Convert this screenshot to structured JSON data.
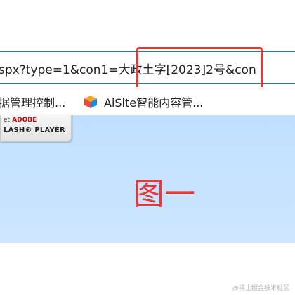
{
  "address_bar": {
    "url_text": "spx?type=1&con1=大政土字[2023]2号&con"
  },
  "bookmarks": [
    {
      "label": "据管理控制..."
    },
    {
      "label": "AiSite智能内容管...",
      "icon": "colorful-cube-icon"
    }
  ],
  "flash_banner": {
    "line1_get": "et",
    "line1_brand": "ADOBE",
    "line2": "LASH® PLAYER"
  },
  "figure_label": "图一",
  "watermark": "@稀土掘金技术社区",
  "colors": {
    "highlight": "#e53935",
    "content_bg": "#cfe6ff",
    "url_focus_border": "#1a73e8"
  }
}
